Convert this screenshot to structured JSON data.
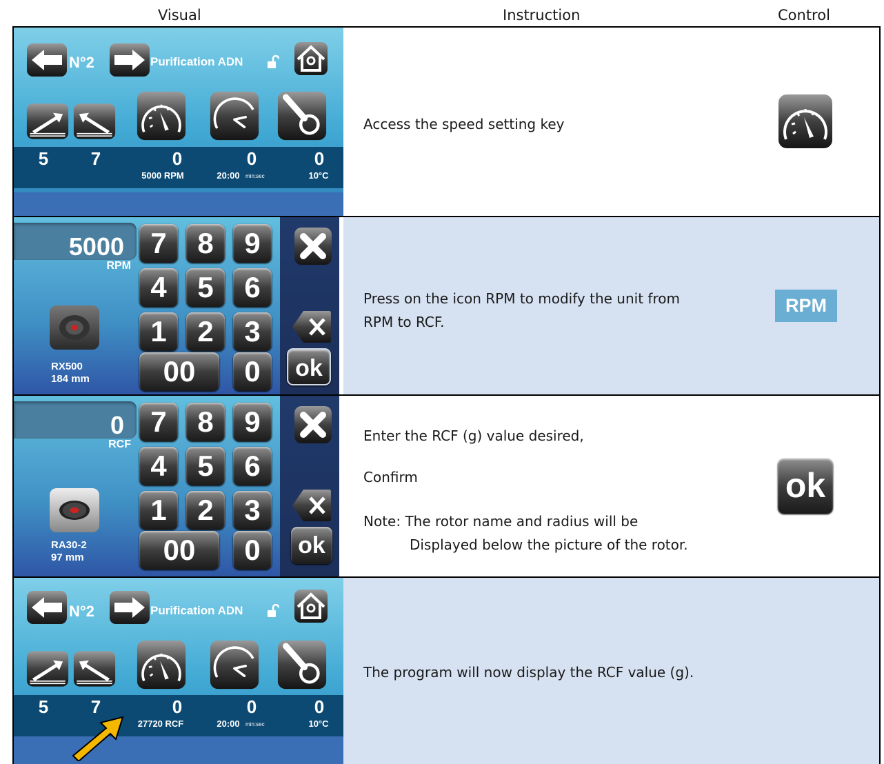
{
  "headers": {
    "visual": "Visual",
    "instruction": "Instruction",
    "control": "Control"
  },
  "screen1": {
    "program": "N°2",
    "name": "Purification ADN",
    "bar": [
      "5",
      "7",
      "0",
      "0",
      "0"
    ],
    "speed": "5000 RPM",
    "time": "20:00",
    "time_unit": "min:sec",
    "temp": "10°C"
  },
  "screen2": {
    "display": "5000",
    "unit": "RPM",
    "keys": [
      "7",
      "8",
      "9",
      "4",
      "5",
      "6",
      "1",
      "2",
      "3",
      "00",
      "0"
    ],
    "ok": "ok",
    "rotor": "RX500",
    "radius": "184 mm"
  },
  "screen3": {
    "display": "0",
    "unit": "RCF",
    "keys": [
      "7",
      "8",
      "9",
      "4",
      "5",
      "6",
      "1",
      "2",
      "3",
      "00",
      "0"
    ],
    "ok": "ok",
    "rotor": "RA30-2",
    "radius": "97 mm"
  },
  "screen4": {
    "program": "N°2",
    "name": "Purification ADN",
    "bar": [
      "5",
      "7",
      "0",
      "0",
      "0"
    ],
    "speed": "27720 RCF",
    "time": "20:00",
    "time_unit": "min:sec",
    "temp": "10°C"
  },
  "rows": [
    {
      "instruction": "Access the speed setting key"
    },
    {
      "instruction_line1": "Press on the icon RPM to modify the unit from",
      "instruction_line2": "RPM to RCF.",
      "control_label": "RPM"
    },
    {
      "instruction_line1": "Enter the RCF (g) value desired,",
      "instruction_line2": "Confirm",
      "instruction_line3": "Note: The rotor name and radius will be",
      "instruction_line4": "Displayed below the picture of the rotor.",
      "control_label": "ok"
    },
    {
      "instruction": "The program will now display the RCF value (g)."
    }
  ],
  "colors": {
    "row_highlight": "#d6e1f1",
    "screen_bar": "#0d4a73",
    "arrow": "#f5b800"
  }
}
